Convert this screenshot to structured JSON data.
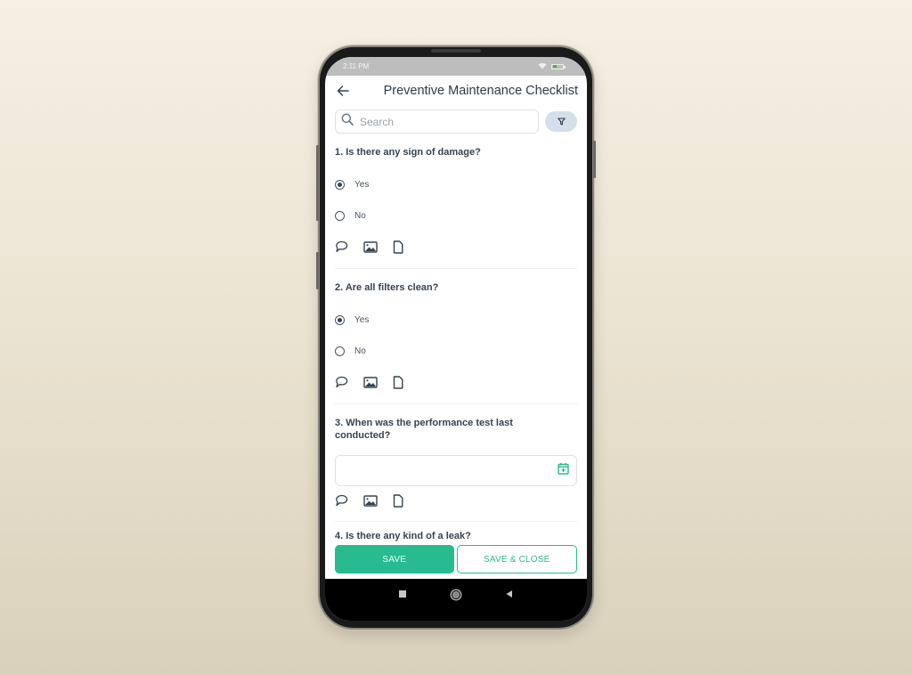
{
  "status_bar": {
    "time": "2:11 PM",
    "icons": [
      "wifi-icon",
      "battery-icon"
    ]
  },
  "app_bar": {
    "back_icon": "arrow-left-icon",
    "title": "Preventive Maintenance Checklist"
  },
  "search": {
    "placeholder": "Search",
    "value": "",
    "icon": "search-icon",
    "filter_icon": "filter-icon"
  },
  "questions": [
    {
      "number": "1.",
      "text": "1. Is there any sign of damage?",
      "type": "radio",
      "options": [
        {
          "label": "Yes",
          "selected": true
        },
        {
          "label": "No",
          "selected": false
        }
      ],
      "attachments": [
        "comment-icon",
        "image-icon",
        "document-icon"
      ]
    },
    {
      "number": "2.",
      "text": "2. Are all filters clean?",
      "type": "radio",
      "options": [
        {
          "label": "Yes",
          "selected": true
        },
        {
          "label": "No",
          "selected": false
        }
      ],
      "attachments": [
        "comment-icon",
        "image-icon",
        "document-icon"
      ]
    },
    {
      "number": "3.",
      "text": "3. When was the performance test last conducted?",
      "type": "date",
      "value": "",
      "attachments": [
        "comment-icon",
        "image-icon",
        "document-icon"
      ]
    },
    {
      "number": "4.",
      "text": "4. Is there any kind of a leak?",
      "type": "radio"
    }
  ],
  "footer": {
    "save_label": "SAVE",
    "save_close_label": "SAVE & CLOSE"
  },
  "nav_bar": {
    "buttons": [
      "recents-icon",
      "home-icon",
      "back-icon"
    ]
  },
  "colors": {
    "accent": "#27bb8f",
    "text": "#37434f",
    "filter_bg": "#d5dfe9",
    "status_bar": "#bdbdbd"
  }
}
